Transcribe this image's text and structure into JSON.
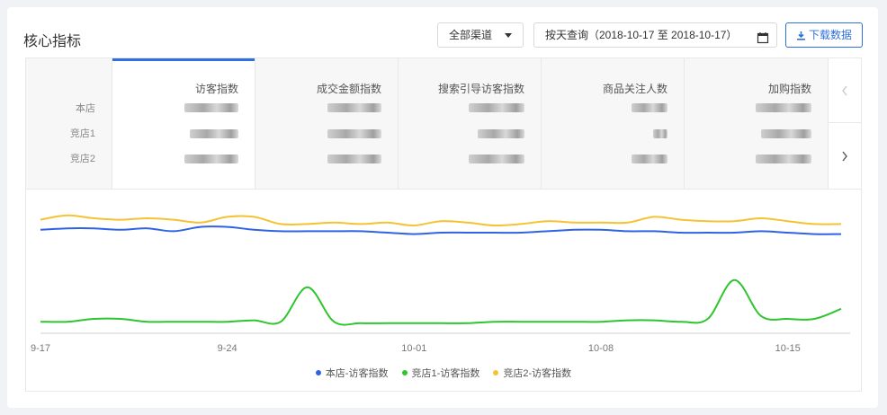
{
  "header": {
    "title": "核心指标",
    "channel_select": "全部渠道",
    "date_range": "按天查询（2018-10-17 至 2018-10-17）",
    "download_label": "下载数据"
  },
  "rows": [
    "本店",
    "竞店1",
    "竞店2"
  ],
  "tabs": [
    {
      "label": "访客指数",
      "active": true
    },
    {
      "label": "成交金额指数",
      "active": false
    },
    {
      "label": "搜索引导访客指数",
      "active": false
    },
    {
      "label": "商品关注人数",
      "active": false
    },
    {
      "label": "加购指数",
      "active": false
    }
  ],
  "colors": {
    "accent": "#2f6fde",
    "series1": "#3062e6",
    "series2": "#2ec52e",
    "series3": "#f5c232"
  },
  "chart_data": {
    "type": "line",
    "x_ticks": [
      "9-17",
      "9-24",
      "10-01",
      "10-08",
      "10-15"
    ],
    "x": [
      "9-17",
      "9-18",
      "9-19",
      "9-20",
      "9-21",
      "9-22",
      "9-23",
      "9-24",
      "9-25",
      "9-26",
      "9-27",
      "9-28",
      "9-29",
      "9-30",
      "10-01",
      "10-02",
      "10-03",
      "10-04",
      "10-05",
      "10-06",
      "10-07",
      "10-08",
      "10-09",
      "10-10",
      "10-11",
      "10-12",
      "10-13",
      "10-14",
      "10-15",
      "10-16",
      "10-17"
    ],
    "ylim": [
      0,
      100
    ],
    "grid": false,
    "legend_position": "bottom",
    "series": [
      {
        "name": "本店-访客指数",
        "color": "#3062e6",
        "values": [
          72,
          73,
          73,
          72,
          73,
          71,
          74,
          74,
          72,
          71,
          71,
          71,
          71,
          70,
          69,
          70,
          70,
          70,
          70,
          71,
          72,
          72,
          71,
          71,
          70,
          70,
          70,
          71,
          70,
          69,
          69
        ]
      },
      {
        "name": "竞店1-访客指数",
        "color": "#2ec52e",
        "values": [
          8,
          8,
          10,
          10,
          8,
          8,
          8,
          8,
          9,
          8,
          32,
          8,
          7,
          7,
          7,
          7,
          7,
          8,
          8,
          8,
          8,
          8,
          9,
          9,
          8,
          10,
          37,
          12,
          10,
          10,
          17
        ]
      },
      {
        "name": "竞店2-访客指数",
        "color": "#f5c232",
        "values": [
          79,
          82,
          80,
          79,
          80,
          79,
          77,
          81,
          81,
          76,
          76,
          77,
          76,
          77,
          75,
          78,
          77,
          75,
          76,
          78,
          77,
          77,
          77,
          81,
          79,
          78,
          78,
          80,
          78,
          76,
          76
        ]
      }
    ]
  }
}
